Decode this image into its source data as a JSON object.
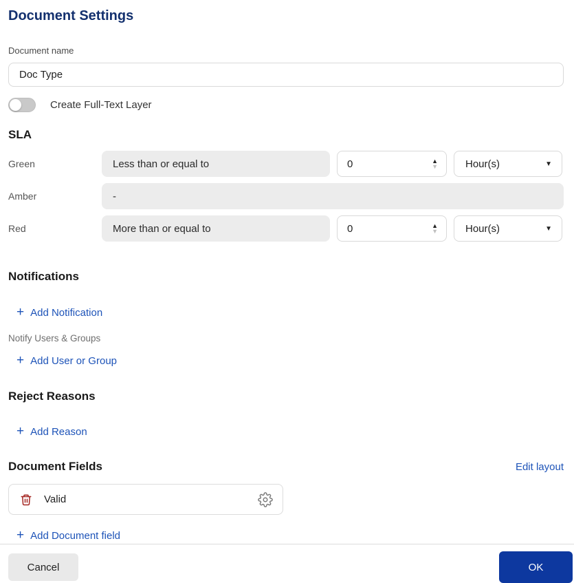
{
  "title": "Document Settings",
  "document_name": {
    "label": "Document name",
    "value": "Doc Type"
  },
  "full_text_toggle": {
    "label": "Create Full-Text Layer",
    "state": "off"
  },
  "sla": {
    "heading": "SLA",
    "rows": [
      {
        "label": "Green",
        "condition": "Less than or equal to",
        "value": "0",
        "unit": "Hour(s)"
      },
      {
        "label": "Amber",
        "condition": "-"
      },
      {
        "label": "Red",
        "condition": "More than or equal to",
        "value": "0",
        "unit": "Hour(s)"
      }
    ]
  },
  "notifications": {
    "heading": "Notifications",
    "add_notification_label": "Add Notification",
    "notify_users_label": "Notify Users & Groups",
    "add_user_or_group_label": "Add User or Group"
  },
  "reject_reasons": {
    "heading": "Reject Reasons",
    "add_reason_label": "Add Reason"
  },
  "document_fields": {
    "heading": "Document Fields",
    "edit_layout_label": "Edit layout",
    "fields": [
      {
        "name": "Valid"
      }
    ],
    "add_field_label": "Add Document field"
  },
  "footer": {
    "cancel_label": "Cancel",
    "ok_label": "OK"
  },
  "icons": {
    "plus": "+",
    "caret_down": "▼",
    "spinner_up": "▲",
    "spinner_down": "▼"
  },
  "colors": {
    "title_navy": "#13306e",
    "link_blue": "#1d53b8",
    "ok_button_blue": "#0d389f",
    "readonly_gray": "#ececec",
    "trash_red": "#a42420"
  }
}
